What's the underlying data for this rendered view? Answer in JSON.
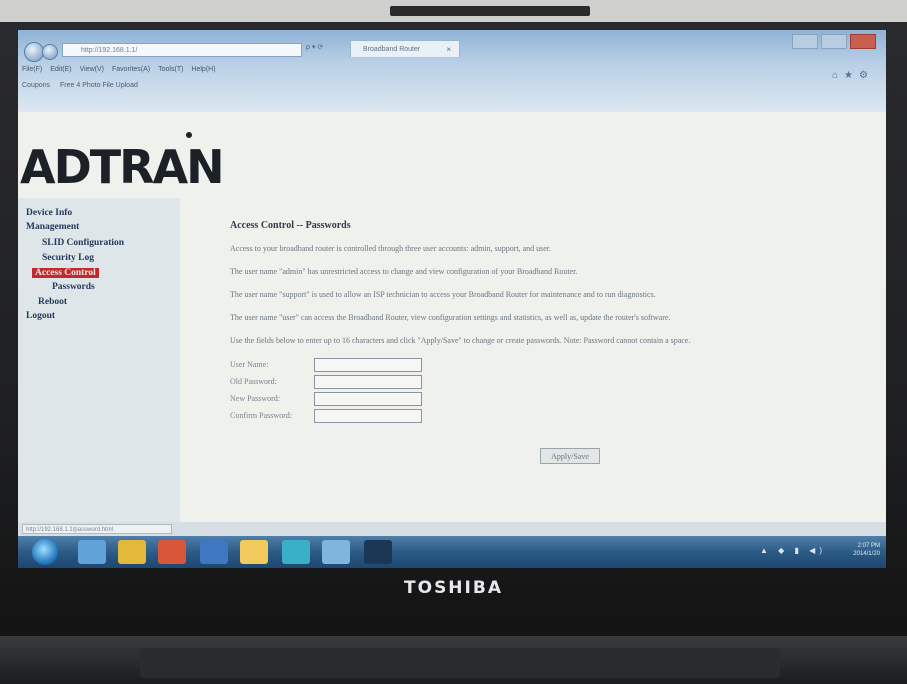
{
  "browser": {
    "address": "http://192.168.1.1/",
    "address_controls": "ρ ▾ ⟳",
    "tab_title": "Broadband Router",
    "tab_close": "×",
    "menu": [
      "File(F)",
      "Edit(E)",
      "View(V)",
      "Favorites(A)",
      "Tools(T)",
      "Help(H)"
    ],
    "favorites": [
      "Coupons",
      "Free 4 Photo File Upload"
    ],
    "status_url": "http://192.168.1.1/password.html"
  },
  "logo": {
    "text": "ADTRAN"
  },
  "sidebar": {
    "items": [
      {
        "label": "Device Info"
      },
      {
        "label": "Management"
      },
      {
        "label": "SLID Configuration"
      },
      {
        "label": "Security Log"
      },
      {
        "label": "Access Control"
      },
      {
        "label": "Passwords"
      },
      {
        "label": "Reboot"
      },
      {
        "label": "Logout"
      }
    ]
  },
  "content": {
    "title": "Access Control -- Passwords",
    "paragraphs": [
      "Access to your broadband router is controlled through three user accounts: admin, support, and user.",
      "The user name \"admin\" has unrestricted access to change and view configuration of your Broadband Router.",
      "The user name \"support\" is used to allow an ISP technician to access your Broadband Router for maintenance and to run diagnostics.",
      "The user name \"user\" can access the Broadband Router, view configuration settings and statistics, as well as, update the router's software.",
      "Use the fields below to enter up to 16 characters and click \"Apply/Save\" to change or create passwords. Note: Password cannot contain a space."
    ],
    "fields": [
      {
        "label": "User Name:",
        "value": ""
      },
      {
        "label": "Old Password:",
        "value": ""
      },
      {
        "label": "New Password:",
        "value": ""
      },
      {
        "label": "Confirm Password:",
        "value": ""
      }
    ],
    "apply_label": "Apply/Save"
  },
  "taskbar": {
    "clock_time": "2:07 PM",
    "clock_date": "2014/1/20"
  },
  "laptop": {
    "brand": "TOSHIBA"
  },
  "colors": {
    "active_menu": "#bf2b2c",
    "taskbar": "#2c5b86"
  }
}
